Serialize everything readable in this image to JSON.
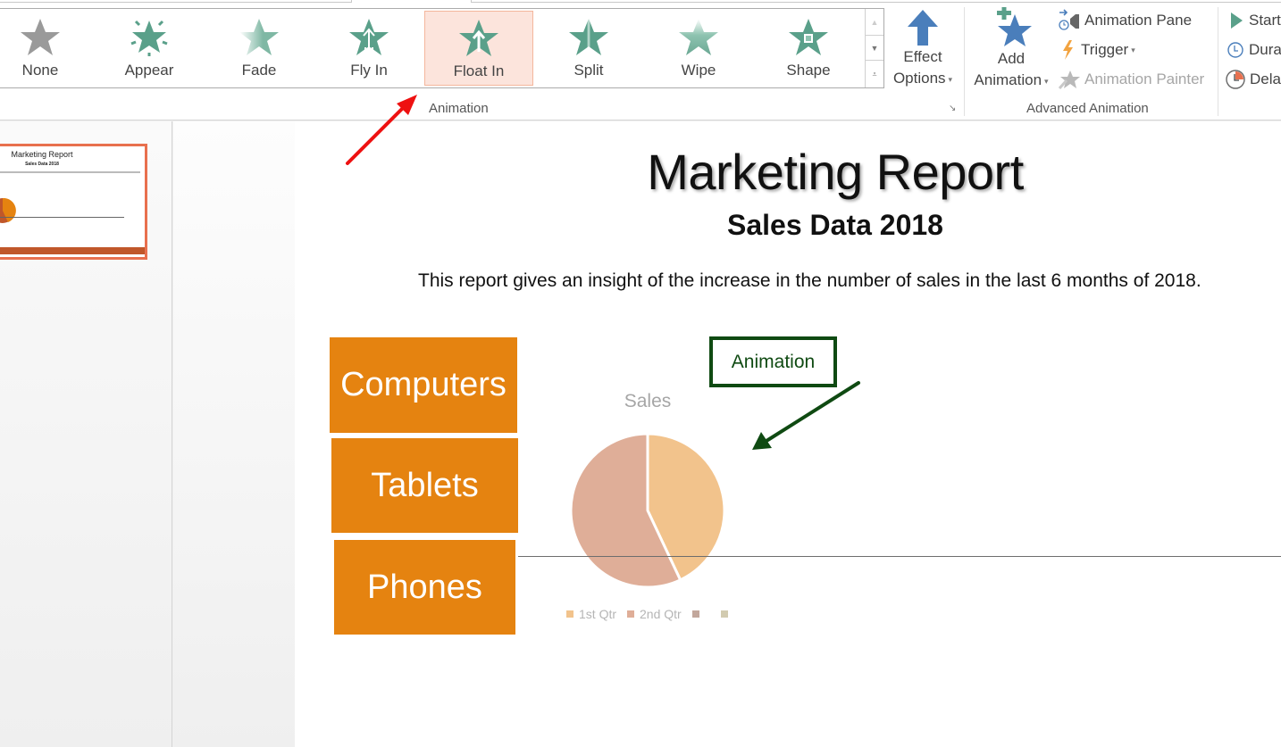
{
  "ribbon": {
    "animation_gallery": {
      "items": [
        {
          "label": "None",
          "icon": "star-none-icon",
          "selected": false
        },
        {
          "label": "Appear",
          "icon": "star-appear-icon",
          "selected": false
        },
        {
          "label": "Fade",
          "icon": "star-fade-icon",
          "selected": false
        },
        {
          "label": "Fly In",
          "icon": "star-fly-in-icon",
          "selected": false
        },
        {
          "label": "Float In",
          "icon": "star-float-in-icon",
          "selected": true
        },
        {
          "label": "Split",
          "icon": "star-split-icon",
          "selected": false
        },
        {
          "label": "Wipe",
          "icon": "star-wipe-icon",
          "selected": false
        },
        {
          "label": "Shape",
          "icon": "star-shape-icon",
          "selected": false
        }
      ],
      "scroll_up": "▲",
      "scroll_down": "▼",
      "more": "⩡"
    },
    "effect_options": {
      "line1": "Effect",
      "line2": "Options"
    },
    "animation_group_label": "Animation",
    "add_animation": {
      "line1": "Add",
      "line2": "Animation"
    },
    "animation_pane": "Animation Pane",
    "trigger": "Trigger",
    "animation_painter": "Animation Painter",
    "advanced_group_label": "Advanced Animation",
    "timing": {
      "start": "Start",
      "duration": "Dura",
      "delay": "Dela"
    },
    "caret": "▾",
    "launcher": "↘"
  },
  "thumbnail": {
    "title": "Marketing Report",
    "subtitle": "Sales Data 2018"
  },
  "slide": {
    "title": "Marketing Report",
    "subtitle": "Sales Data 2018",
    "body": "This report gives an insight of the increase in the number of sales in the last 6 months of 2018.",
    "categories": [
      "Computers",
      "Tablets",
      "Phones"
    ],
    "callout": "Animation"
  },
  "colors": {
    "accent_orange": "#e58310",
    "selected_bg": "#fce4dc",
    "callout_green": "#0f4a12",
    "arrow_red": "#ee1111",
    "star_green": "#5aa08a",
    "blue": "#4a7ebb"
  },
  "chart_data": {
    "type": "pie",
    "title": "Sales",
    "categories": [
      "1st Qtr",
      "2nd Qtr",
      "",
      ""
    ],
    "values": [
      43,
      57,
      0,
      0
    ],
    "colors": [
      "#f2c38c",
      "#dfae98",
      "#c2a79c",
      "#d2cbb0"
    ],
    "legend": [
      "1st Qtr",
      "2nd Qtr",
      "",
      ""
    ],
    "legend_position": "bottom"
  }
}
